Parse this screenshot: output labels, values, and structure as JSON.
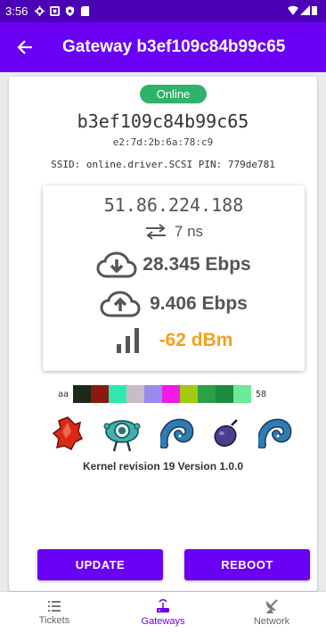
{
  "status_bar": {
    "time": "3:56"
  },
  "app_bar": {
    "title": "Gateway b3ef109c84b99c65"
  },
  "gateway": {
    "status": "Online",
    "id": "b3ef109c84b99c65",
    "mac": "e2:7d:2b:6a:78:c9",
    "ssid_line": "SSID: online.driver.SCSI  PIN: 779de781"
  },
  "stats": {
    "ip": "51.86.224.188",
    "latency": "7 ns",
    "download": "28.345 Ebps",
    "upload": "9.406 Ebps",
    "signal": "-62 dBm"
  },
  "color_strip": {
    "start_label": "aa",
    "end_label": "58",
    "colors": [
      "#1a2a1a",
      "#8b1a0c",
      "#2ee8b0",
      "#c8bcc8",
      "#9a8af0",
      "#f21ae6",
      "#a4c80c",
      "#2aa048",
      "#1c8c40",
      "#6ee89a"
    ]
  },
  "icons": [
    "red-crystal-icon",
    "robot-drone-icon",
    "blue-snake-icon",
    "purple-plum-icon",
    "blue-snake-icon"
  ],
  "kernel_line": "Kernel revision 19  Version 1.0.0",
  "buttons": {
    "update": "UPDATE",
    "reboot": "REBOOT"
  },
  "bottom_nav": {
    "tickets": "Tickets",
    "gateways": "Gateways",
    "network": "Network"
  },
  "colors": {
    "primary": "#6a00f4",
    "status_bar": "#4b00b5",
    "online": "#2fb36a",
    "signal": "#f4a01c"
  }
}
